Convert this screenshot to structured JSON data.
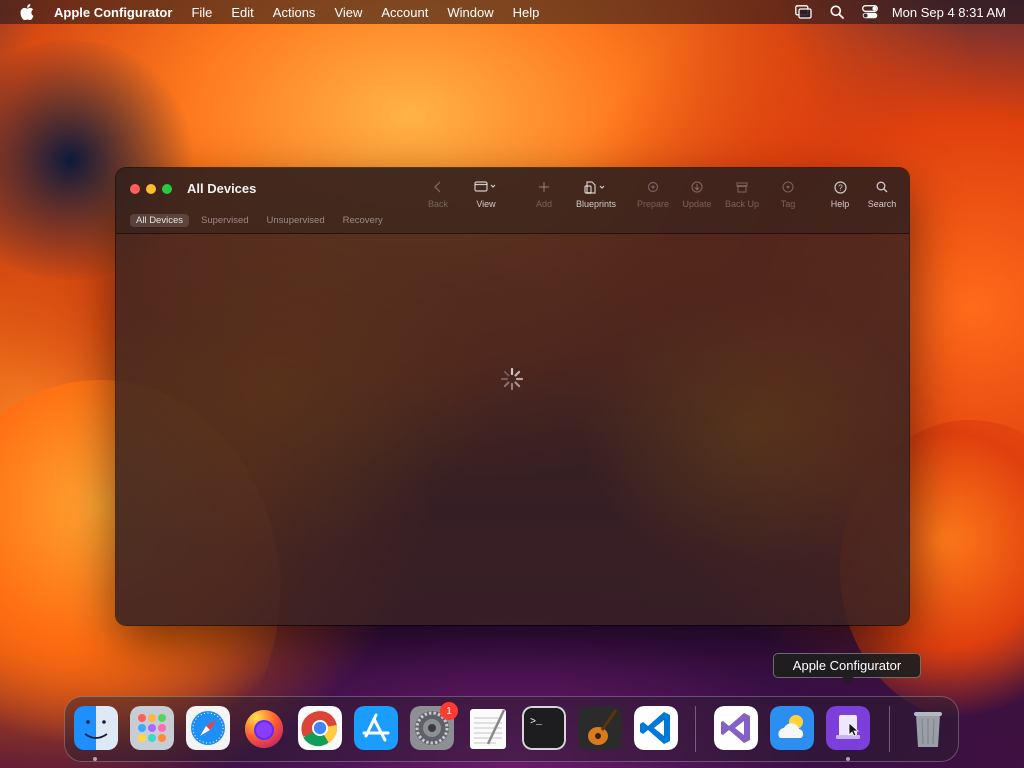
{
  "menubar": {
    "apple_icon": "apple-logo-icon",
    "app_name": "Apple Configurator",
    "menus": [
      "File",
      "Edit",
      "Actions",
      "View",
      "Account",
      "Window",
      "Help"
    ],
    "status_icons": [
      "screen-mirroring-icon",
      "spotlight-search-icon",
      "control-center-icon"
    ],
    "clock": "Mon Sep 4  8:31 AM"
  },
  "window": {
    "title": "All Devices",
    "toolbar": {
      "back": "Back",
      "view": "View",
      "add": "Add",
      "blueprints": "Blueprints",
      "prepare": "Prepare",
      "update": "Update",
      "backup": "Back Up",
      "tag": "Tag",
      "help": "Help",
      "search": "Search"
    },
    "tabs": [
      "All Devices",
      "Supervised",
      "Unsupervised",
      "Recovery"
    ],
    "selected_tab": "All Devices",
    "loading": "spinner-icon"
  },
  "tooltip": "Apple Configurator",
  "dock": {
    "apps": [
      "Finder",
      "Launchpad",
      "Safari",
      "Firefox",
      "Google Chrome",
      "App Store",
      "System Settings",
      "TextEdit",
      "Terminal",
      "GarageBand",
      "Visual Studio Code",
      "Visual Studio",
      "Weather",
      "Apple Configurator",
      "Trash"
    ],
    "system_settings_badge": "1"
  },
  "colors": {
    "close": "#ff5f57",
    "minimize": "#febc2e",
    "maximize": "#28c840",
    "badge": "#ff3b30"
  }
}
